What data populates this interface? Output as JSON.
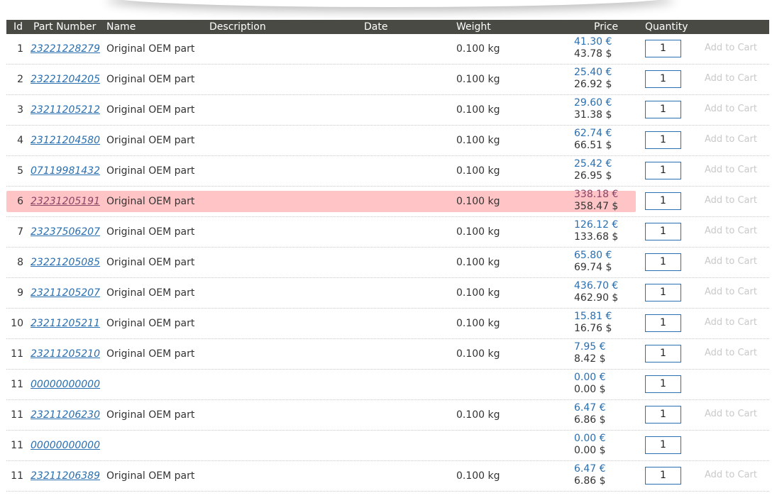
{
  "columns": {
    "id": "Id",
    "part_number": "Part Number",
    "name": "Name",
    "description": "Description",
    "date": "Date",
    "weight": "Weight",
    "price": "Price",
    "quantity": "Quantity"
  },
  "add_to_cart_label": "Add to Cart",
  "highlight_color": "#ffc4c6",
  "link_color": "#2a6fb0",
  "rows": [
    {
      "id": "1",
      "part": "23221228279",
      "name": "Original OEM part",
      "weight": "0.100 kg",
      "eur": "41.30 €",
      "usd": "43.78 $",
      "qty": "1",
      "cart": true,
      "highlight": false
    },
    {
      "id": "2",
      "part": "23221204205",
      "name": "Original OEM part",
      "weight": "0.100 kg",
      "eur": "25.40 €",
      "usd": "26.92 $",
      "qty": "1",
      "cart": true,
      "highlight": false
    },
    {
      "id": "3",
      "part": "23211205212",
      "name": "Original OEM part",
      "weight": "0.100 kg",
      "eur": "29.60 €",
      "usd": "31.38 $",
      "qty": "1",
      "cart": true,
      "highlight": false
    },
    {
      "id": "4",
      "part": "23121204580",
      "name": "Original OEM part",
      "weight": "0.100 kg",
      "eur": "62.74 €",
      "usd": "66.51 $",
      "qty": "1",
      "cart": true,
      "highlight": false
    },
    {
      "id": "5",
      "part": "07119981432",
      "name": "Original OEM part",
      "weight": "0.100 kg",
      "eur": "25.42 €",
      "usd": "26.95 $",
      "qty": "1",
      "cart": true,
      "highlight": false
    },
    {
      "id": "6",
      "part": "23231205191",
      "name": "Original OEM part",
      "weight": "0.100 kg",
      "eur": "338.18 €",
      "usd": "358.47 $",
      "qty": "1",
      "cart": true,
      "highlight": true
    },
    {
      "id": "7",
      "part": "23237506207",
      "name": "Original OEM part",
      "weight": "0.100 kg",
      "eur": "126.12 €",
      "usd": "133.68 $",
      "qty": "1",
      "cart": true,
      "highlight": false
    },
    {
      "id": "8",
      "part": "23221205085",
      "name": "Original OEM part",
      "weight": "0.100 kg",
      "eur": "65.80 €",
      "usd": "69.74 $",
      "qty": "1",
      "cart": true,
      "highlight": false
    },
    {
      "id": "9",
      "part": "23211205207",
      "name": "Original OEM part",
      "weight": "0.100 kg",
      "eur": "436.70 €",
      "usd": "462.90 $",
      "qty": "1",
      "cart": true,
      "highlight": false
    },
    {
      "id": "10",
      "part": "23211205211",
      "name": "Original OEM part",
      "weight": "0.100 kg",
      "eur": "15.81 €",
      "usd": "16.76 $",
      "qty": "1",
      "cart": true,
      "highlight": false
    },
    {
      "id": "11",
      "part": "23211205210",
      "name": "Original OEM part",
      "weight": "0.100 kg",
      "eur": "7.95 €",
      "usd": "8.42 $",
      "qty": "1",
      "cart": true,
      "highlight": false
    },
    {
      "id": "11",
      "part": "00000000000",
      "name": "",
      "weight": "",
      "eur": "0.00 €",
      "usd": "0.00 $",
      "qty": "1",
      "cart": false,
      "highlight": false
    },
    {
      "id": "11",
      "part": "23211206230",
      "name": "Original OEM part",
      "weight": "0.100 kg",
      "eur": "6.47 €",
      "usd": "6.86 $",
      "qty": "1",
      "cart": true,
      "highlight": false
    },
    {
      "id": "11",
      "part": "00000000000",
      "name": "",
      "weight": "",
      "eur": "0.00 €",
      "usd": "0.00 $",
      "qty": "1",
      "cart": false,
      "highlight": false
    },
    {
      "id": "11",
      "part": "23211206389",
      "name": "Original OEM part",
      "weight": "0.100 kg",
      "eur": "6.47 €",
      "usd": "6.86 $",
      "qty": "1",
      "cart": true,
      "highlight": false
    }
  ]
}
